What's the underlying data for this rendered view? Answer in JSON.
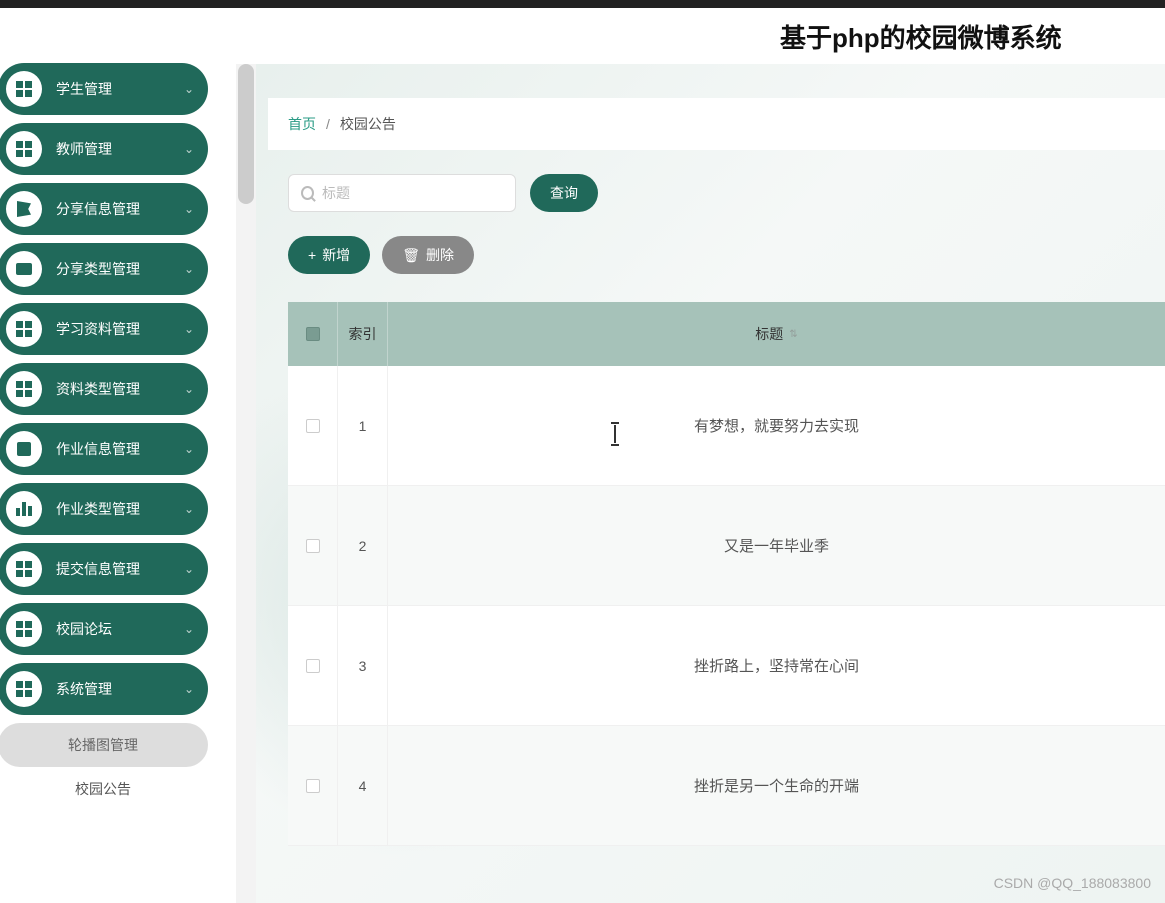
{
  "header": {
    "title": "基于php的校园微博系统"
  },
  "sidebar": {
    "items": [
      {
        "label": "学生管理",
        "icon": "grid"
      },
      {
        "label": "教师管理",
        "icon": "grid"
      },
      {
        "label": "分享信息管理",
        "icon": "flag"
      },
      {
        "label": "分享类型管理",
        "icon": "msg"
      },
      {
        "label": "学习资料管理",
        "icon": "grid"
      },
      {
        "label": "资料类型管理",
        "icon": "grid"
      },
      {
        "label": "作业信息管理",
        "icon": "stop"
      },
      {
        "label": "作业类型管理",
        "icon": "bars"
      },
      {
        "label": "提交信息管理",
        "icon": "grid"
      },
      {
        "label": "校园论坛",
        "icon": "grid"
      },
      {
        "label": "系统管理",
        "icon": "grid"
      }
    ],
    "subitems": [
      {
        "label": "轮播图管理",
        "active": true
      },
      {
        "label": "校园公告",
        "active": false
      }
    ]
  },
  "breadcrumb": {
    "home": "首页",
    "sep": "/",
    "current": "校园公告"
  },
  "search": {
    "placeholder": "标题",
    "button": "查询"
  },
  "actions": {
    "add": "新增",
    "delete": "删除"
  },
  "table": {
    "headers": {
      "index": "索引",
      "title": "标题"
    },
    "rows": [
      {
        "index": "1",
        "title": "有梦想，就要努力去实现"
      },
      {
        "index": "2",
        "title": "又是一年毕业季"
      },
      {
        "index": "3",
        "title": "挫折路上，坚持常在心间"
      },
      {
        "index": "4",
        "title": "挫折是另一个生命的开端"
      }
    ]
  },
  "watermark": "CSDN @QQ_188083800"
}
